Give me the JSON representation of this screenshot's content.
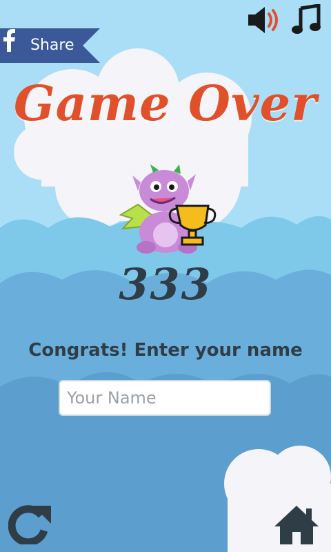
{
  "screen": "game-over",
  "share": {
    "label": "Share",
    "icon": "facebook-icon"
  },
  "controls": {
    "sound_icon": "speaker-icon",
    "music_icon": "music-note-icon"
  },
  "title": "Game Over",
  "score": "333",
  "prompt": "Congrats! Enter your name",
  "name_input": {
    "placeholder": "Your Name",
    "value": ""
  },
  "bottom": {
    "restart_icon": "restart-arrow-icon",
    "home_icon": "home-icon"
  },
  "colors": {
    "sky": "#a9def6",
    "hill_light": "#7ec8ea",
    "hill_mid": "#6aafdc",
    "hill_dark": "#5c9fce",
    "cloud": "#f5f4f8",
    "title": "#e0502a",
    "text_dark": "#2f3d47",
    "facebook": "#3b5998"
  }
}
